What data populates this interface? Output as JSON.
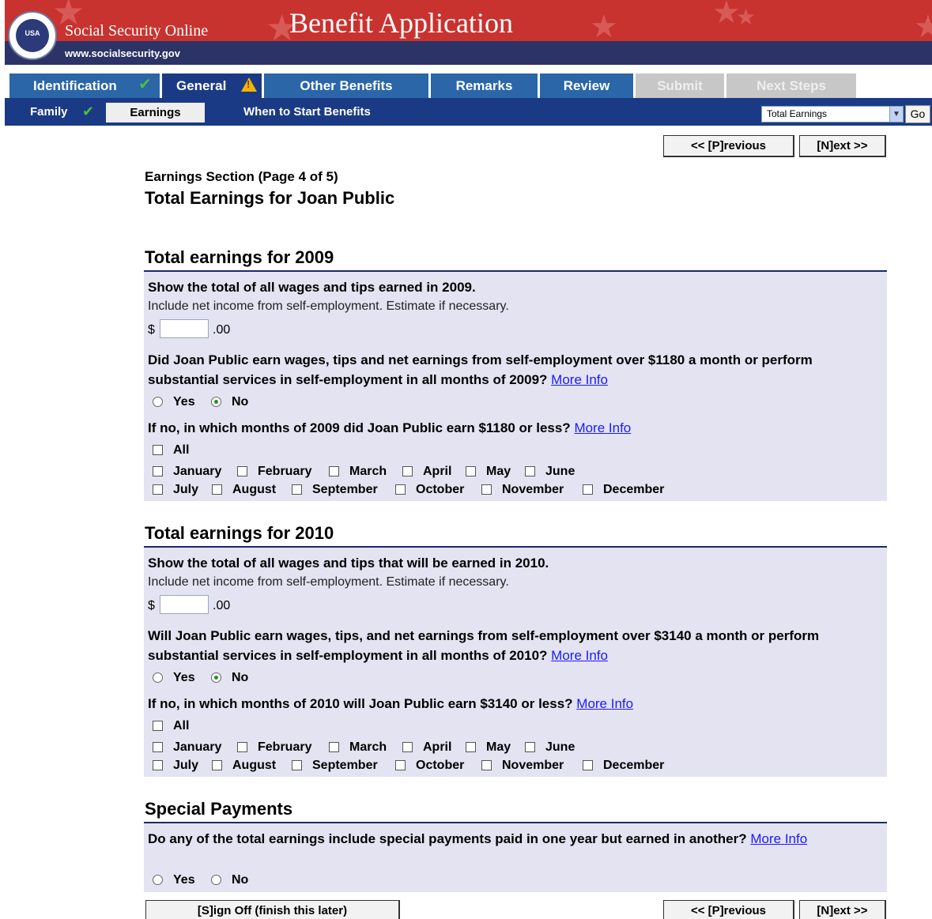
{
  "header": {
    "brand": "Social Security Online",
    "url": "www.socialsecurity.gov",
    "title": "Benefit Application",
    "seal_text": "USA"
  },
  "tabs": [
    {
      "label": "Identification",
      "status": "complete"
    },
    {
      "label": "General",
      "status": "warning"
    },
    {
      "label": "Other Benefits",
      "status": "enabled"
    },
    {
      "label": "Remarks",
      "status": "enabled"
    },
    {
      "label": "Review",
      "status": "enabled"
    },
    {
      "label": "Submit",
      "status": "disabled"
    },
    {
      "label": "Next Steps",
      "status": "disabled"
    }
  ],
  "subtabs": [
    {
      "label": "Family",
      "status": "complete"
    },
    {
      "label": "Earnings",
      "status": "active"
    },
    {
      "label": "When to Start Benefits",
      "status": "enabled"
    }
  ],
  "jump": {
    "selected": "Total Earnings",
    "go_label": "Go"
  },
  "nav": {
    "previous": "<< [P]revious",
    "next": "[N]ext >>",
    "signoff": "[S]ign Off (finish this later)"
  },
  "page": {
    "section_caption": "Earnings Section (Page 4 of 5)",
    "title": "Total Earnings for Joan Public"
  },
  "more_info": "More Info",
  "sections": [
    {
      "title": "Total earnings for 2009",
      "wage_question": "Show the total of all wages and tips earned in 2009.",
      "hint": "Include net income from self-employment. Estimate if necessary.",
      "currency": "$",
      "amount_value": "",
      "cents": ".00",
      "threshold_question": "Did Joan Public earn wages, tips and net earnings from self-employment over $1180 a month or perform substantial services in self-employment in all months of 2009?",
      "yes_label": "Yes",
      "no_label": "No",
      "selected": "No",
      "months_question": "If no, in which months of 2009 did Joan Public earn $1180 or less?",
      "all_label": "All",
      "months_row1": [
        "January",
        "February",
        "March",
        "April",
        "May",
        "June"
      ],
      "months_row2": [
        "July",
        "August",
        "September",
        "October",
        "November",
        "December"
      ]
    },
    {
      "title": "Total earnings for 2010",
      "wage_question": "Show the total of all wages and tips that will be earned in 2010.",
      "hint": "Include net income from self-employment. Estimate if necessary.",
      "currency": "$",
      "amount_value": "",
      "cents": ".00",
      "threshold_question": "Will Joan Public earn wages, tips, and net earnings from self-employment over $3140 a month or perform substantial services in self-employment in all months of 2010?",
      "yes_label": "Yes",
      "no_label": "No",
      "selected": "No",
      "months_question": "If no, in which months of 2010 will Joan Public earn $3140 or less?",
      "all_label": "All",
      "months_row1": [
        "January",
        "February",
        "March",
        "April",
        "May",
        "June"
      ],
      "months_row2": [
        "July",
        "August",
        "September",
        "October",
        "November",
        "December"
      ]
    }
  ],
  "special": {
    "title": "Special Payments",
    "question_line1": "Do any of the total earnings include special payments paid in one year but earned in another?",
    "more_info_part1": "More",
    "more_info_part2": "Info",
    "yes_label": "Yes",
    "no_label": "No",
    "selected": ""
  },
  "colors": {
    "header_red": "#c8332f",
    "header_navy": "#2c3366",
    "tab_blue": "#2a66a8",
    "tab_active": "#1b3a86",
    "panel": "#e3e3f2",
    "link": "#1a1aff"
  }
}
